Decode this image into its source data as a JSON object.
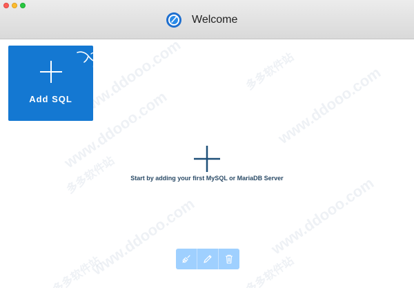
{
  "window": {
    "title": "Welcome",
    "app_icon": "sql-app-icon",
    "controls": [
      "close",
      "minimize",
      "zoom"
    ]
  },
  "add_tile": {
    "label": "Add SQL",
    "icon": "plus-icon",
    "badge_icon": "mysql-dolphin-icon",
    "color": "#1478d2"
  },
  "empty_state": {
    "icon": "plus-icon",
    "message": "Start by adding your first MySQL or MariaDB Server",
    "color": "#1d4f78"
  },
  "toolbar": {
    "buttons": [
      {
        "icon": "connect-plug-icon",
        "enabled": false
      },
      {
        "icon": "pencil-edit-icon",
        "enabled": false
      },
      {
        "icon": "trash-icon",
        "enabled": false
      }
    ],
    "color": "#9fd0ff"
  },
  "watermark": {
    "text": "www.ddooo.com",
    "text_cn": "多多软件站"
  }
}
